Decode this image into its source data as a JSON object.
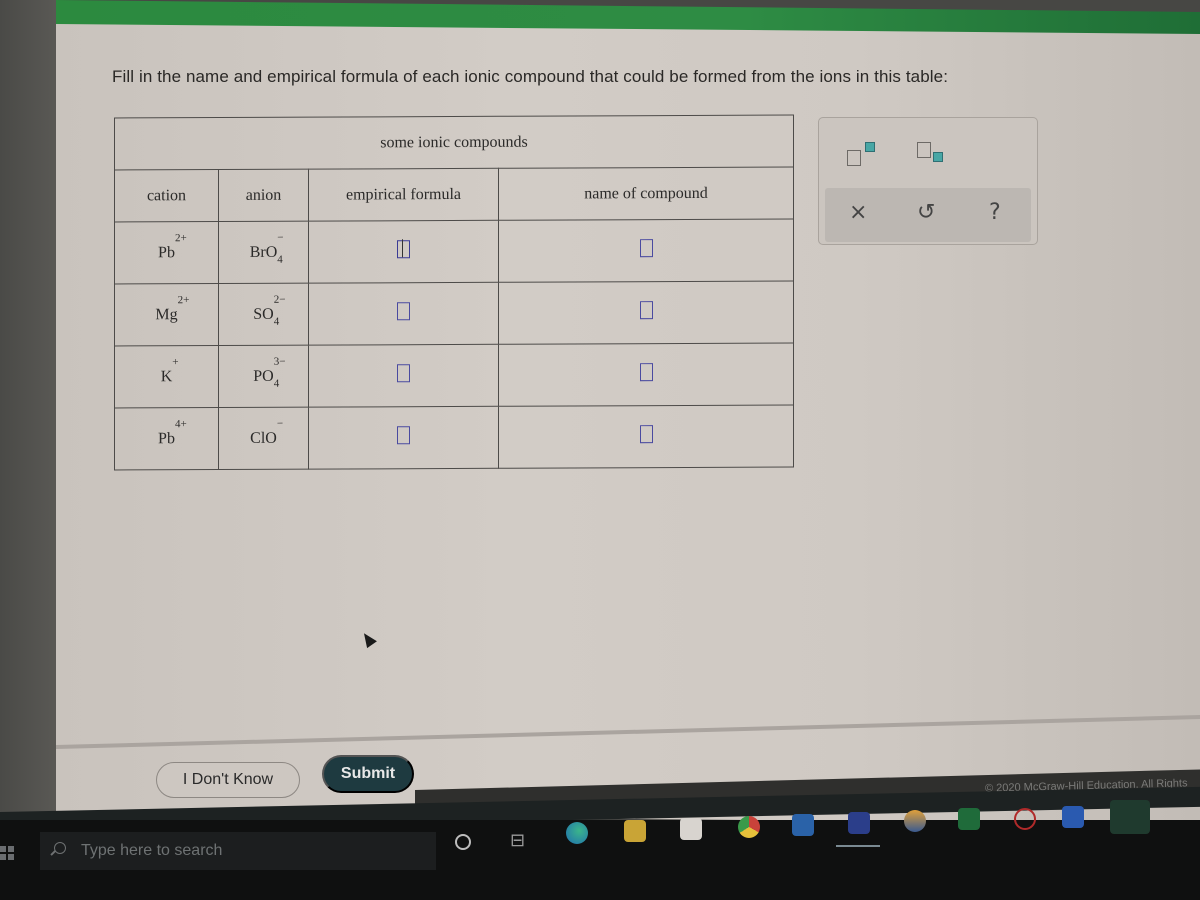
{
  "instruction": "Fill in the name and empirical formula of each ionic compound that could be formed from the ions in this table:",
  "table": {
    "title": "some ionic compounds",
    "headers": [
      "cation",
      "anion",
      "empirical formula",
      "name of compound"
    ],
    "rows": [
      {
        "cation": {
          "symbol": "Pb",
          "charge": "2+"
        },
        "anion": {
          "symbol": "BrO",
          "subscript": "4",
          "charge": "−"
        },
        "empirical_formula": "",
        "name": ""
      },
      {
        "cation": {
          "symbol": "Mg",
          "charge": "2+"
        },
        "anion": {
          "symbol": "SO",
          "subscript": "4",
          "charge": "2−"
        },
        "empirical_formula": "",
        "name": ""
      },
      {
        "cation": {
          "symbol": "K",
          "charge": "+"
        },
        "anion": {
          "symbol": "PO",
          "subscript": "4",
          "charge": "3−"
        },
        "empirical_formula": "",
        "name": ""
      },
      {
        "cation": {
          "symbol": "Pb",
          "charge": "4+"
        },
        "anion": {
          "symbol": "ClO",
          "subscript": "",
          "charge": "−"
        },
        "empirical_formula": "",
        "name": ""
      }
    ]
  },
  "toolbox": {
    "tools": [
      {
        "name": "superscript-template",
        "icon": "superscript-icon"
      },
      {
        "name": "subscript-template",
        "icon": "subscript-icon"
      }
    ],
    "actions": [
      {
        "name": "clear",
        "glyph": "×"
      },
      {
        "name": "undo",
        "glyph": "↺"
      },
      {
        "name": "help",
        "glyph": "?"
      }
    ]
  },
  "buttons": {
    "dont_know": "I Don't Know",
    "submit": "Submit"
  },
  "footer": {
    "copyright": "© 2020 McGraw-Hill Education. All Rights"
  },
  "taskbar": {
    "search_placeholder": "Type here to search",
    "apps": [
      "edge",
      "file-explorer",
      "store",
      "chrome",
      "calendar",
      "word",
      "app-orange",
      "excel",
      "app-red",
      "zoom",
      "chrome-active"
    ]
  },
  "colors": {
    "header_green": "#2e8c44",
    "submit_bg": "#1e3a40",
    "input_border": "#4a4aa0",
    "tool_teal": "#48a7a5"
  }
}
